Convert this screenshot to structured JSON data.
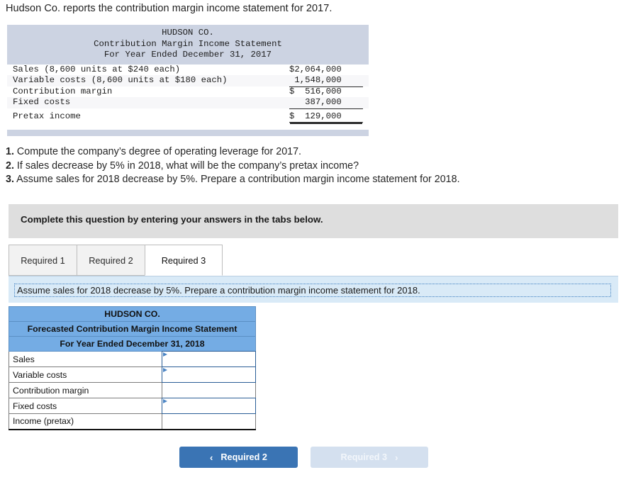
{
  "intro": "Hudson Co. reports the contribution margin income statement for 2017.",
  "statement_2017": {
    "title_lines": [
      "HUDSON CO.",
      "Contribution Margin Income Statement",
      "For Year Ended December 31, 2017"
    ],
    "rows": [
      {
        "label": "Sales (8,600 units at $240 each)",
        "amount": "$2,064,000",
        "rule": "none"
      },
      {
        "label": "Variable costs (8,600 units at $180 each)",
        "amount": " 1,548,000",
        "rule": "single"
      },
      {
        "label": "Contribution margin",
        "amount": "$  516,000",
        "rule": "none"
      },
      {
        "label": "Fixed costs",
        "amount": "   387,000",
        "rule": "single"
      },
      {
        "label": "Pretax income",
        "amount": "$  129,000",
        "rule": "double"
      }
    ]
  },
  "requirements": [
    {
      "num": "1.",
      "text": "Compute the company’s degree of operating leverage for 2017."
    },
    {
      "num": "2.",
      "text": "If sales decrease by 5% in 2018, what will be the company’s pretax income?"
    },
    {
      "num": "3.",
      "text": "Assume sales for 2018 decrease by 5%. Prepare a contribution margin income statement for 2018."
    }
  ],
  "gray_banner": "Complete this question by entering your answers in the tabs below.",
  "tabs": [
    {
      "label": "Required 1",
      "active": false
    },
    {
      "label": "Required 2",
      "active": false
    },
    {
      "label": "Required 3",
      "active": true
    }
  ],
  "blue_banner": "Assume sales for 2018 decrease by 5%. Prepare a contribution margin income statement for 2018.",
  "forecast_table": {
    "headers": [
      "HUDSON CO.",
      "Forecasted Contribution Margin Income Statement",
      "For Year Ended December 31, 2018"
    ],
    "rows": [
      {
        "label": "Sales",
        "value": "",
        "editable": true
      },
      {
        "label": "Variable costs",
        "value": "",
        "editable": true
      },
      {
        "label": "Contribution margin",
        "value": "",
        "editable": false
      },
      {
        "label": "Fixed costs",
        "value": "",
        "editable": true
      },
      {
        "label": "Income (pretax)",
        "value": "",
        "editable": false
      }
    ]
  },
  "nav": {
    "prev_label": "Required 2",
    "prev_chevron": "‹",
    "next_label": "Required 3",
    "next_chevron": "›"
  },
  "colors": {
    "statement_header_bg": "#ccd3e2",
    "table_header_bg": "#74ace4",
    "banner_gray": "#dedede",
    "banner_blue": "#d9eaf7",
    "prev_button": "#3a74b4",
    "next_button": "#d4e0ef"
  }
}
